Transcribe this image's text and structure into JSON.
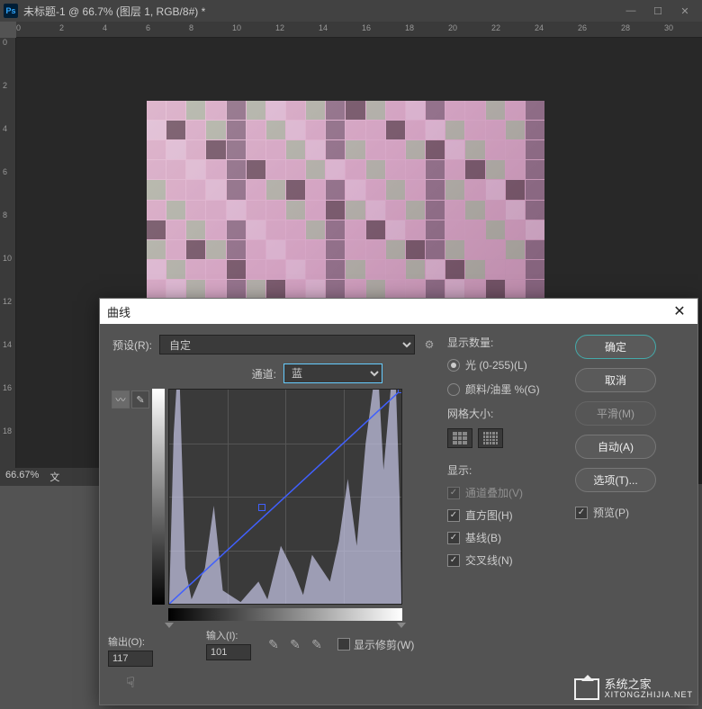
{
  "window": {
    "title": "未标题-1 @ 66.7% (图层 1, RGB/8#) *"
  },
  "ruler_h": [
    0,
    2,
    4,
    6,
    8,
    10,
    12,
    14,
    16,
    18,
    20,
    22,
    24,
    26,
    28,
    30
  ],
  "ruler_v": [
    0,
    2,
    4,
    6,
    8,
    10,
    12,
    14,
    16,
    18
  ],
  "status": {
    "zoom": "66.67%",
    "label": "文"
  },
  "dialog": {
    "title": "曲线",
    "preset_label": "预设(R):",
    "preset_value": "自定",
    "channel_label": "通道:",
    "channel_value": "蓝",
    "output_label": "输出(O):",
    "output_value": "117",
    "input_label": "输入(I):",
    "input_value": "101",
    "show_clip": "显示修剪(W)",
    "display_amount_label": "显示数量:",
    "display_light": "光 (0-255)(L)",
    "display_pigment": "颜料/油墨 %(G)",
    "grid_size_label": "网格大小:",
    "show_label": "显示:",
    "channel_overlay": "通道叠加(V)",
    "histogram_check": "直方图(H)",
    "baseline": "基线(B)",
    "intersection": "交叉线(N)",
    "btn_ok": "确定",
    "btn_cancel": "取消",
    "btn_smooth": "平滑(M)",
    "btn_auto": "自动(A)",
    "btn_options": "选项(T)...",
    "preview": "预览(P)"
  },
  "watermark": {
    "main": "系统之家",
    "sub": "XITONGZHIJIA.NET"
  }
}
